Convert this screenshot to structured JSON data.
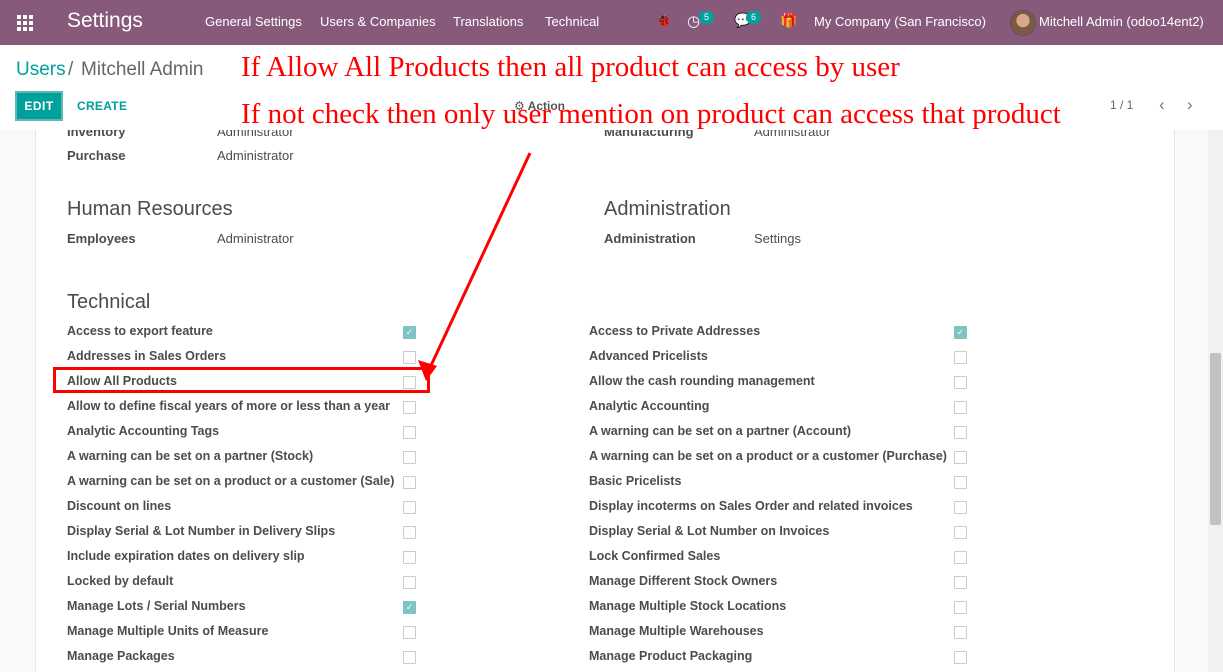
{
  "navbar": {
    "app_title": "Settings",
    "menus": [
      "General Settings",
      "Users & Companies",
      "Translations",
      "Technical"
    ],
    "activity_count": "5",
    "message_count": "6",
    "company": "My Company (San Francisco)",
    "user": "Mitchell Admin (odoo14ent2)"
  },
  "breadcrumb": {
    "parent": "Users",
    "separator": "/",
    "current": "Mitchell Admin"
  },
  "buttons": {
    "edit": "EDIT",
    "create": "CREATE",
    "action": "Action"
  },
  "pager": "1 / 1",
  "access_rights": {
    "partial_rows": [
      {
        "label": "Inventory",
        "value": "Administrator"
      },
      {
        "label": "Manufacturing",
        "value": "Administrator"
      }
    ],
    "purchase": {
      "label": "Purchase",
      "value": "Administrator"
    },
    "human_resources": {
      "title": "Human Resources",
      "label": "Employees",
      "value": "Administrator"
    },
    "administration": {
      "title": "Administration",
      "label": "Administration",
      "value": "Settings"
    }
  },
  "technical": {
    "title": "Technical",
    "left": [
      {
        "label": "Access to export feature",
        "checked": true
      },
      {
        "label": "Addresses in Sales Orders",
        "checked": false
      },
      {
        "label": "Allow All Products",
        "checked": false
      },
      {
        "label": "Allow to define fiscal years of more or less than a year",
        "checked": false
      },
      {
        "label": "Analytic Accounting Tags",
        "checked": false
      },
      {
        "label": "A warning can be set on a partner (Stock)",
        "checked": false
      },
      {
        "label": "A warning can be set on a product or a customer (Sale)",
        "checked": false
      },
      {
        "label": "Discount on lines",
        "checked": false
      },
      {
        "label": "Display Serial & Lot Number in Delivery Slips",
        "checked": false
      },
      {
        "label": "Include expiration dates on delivery slip",
        "checked": false
      },
      {
        "label": "Locked by default",
        "checked": false
      },
      {
        "label": "Manage Lots / Serial Numbers",
        "checked": true
      },
      {
        "label": "Manage Multiple Units of Measure",
        "checked": false
      },
      {
        "label": "Manage Packages",
        "checked": false
      }
    ],
    "right": [
      {
        "label": "Access to Private Addresses",
        "checked": true
      },
      {
        "label": "Advanced Pricelists",
        "checked": false
      },
      {
        "label": "Allow the cash rounding management",
        "checked": false
      },
      {
        "label": "Analytic Accounting",
        "checked": false
      },
      {
        "label": "A warning can be set on a partner (Account)",
        "checked": false
      },
      {
        "label": "A warning can be set on a product or a customer (Purchase)",
        "checked": false
      },
      {
        "label": "Basic Pricelists",
        "checked": false
      },
      {
        "label": "Display incoterms on Sales Order and related invoices",
        "checked": false
      },
      {
        "label": "Display Serial & Lot Number on Invoices",
        "checked": false
      },
      {
        "label": "Lock Confirmed Sales",
        "checked": false
      },
      {
        "label": "Manage Different Stock Owners",
        "checked": false
      },
      {
        "label": "Manage Multiple Stock Locations",
        "checked": false
      },
      {
        "label": "Manage Multiple Warehouses",
        "checked": false
      },
      {
        "label": "Manage Product Packaging",
        "checked": false
      }
    ]
  },
  "annotation": {
    "line1": "If Allow All Products then all product can access by user",
    "line2": "If not check then only user mention on product can access that product",
    "color": "#ff0000"
  },
  "colors": {
    "navbar": "#875a7b",
    "primary": "#00a09d",
    "checkbox_checked": "#7dc4c3"
  }
}
